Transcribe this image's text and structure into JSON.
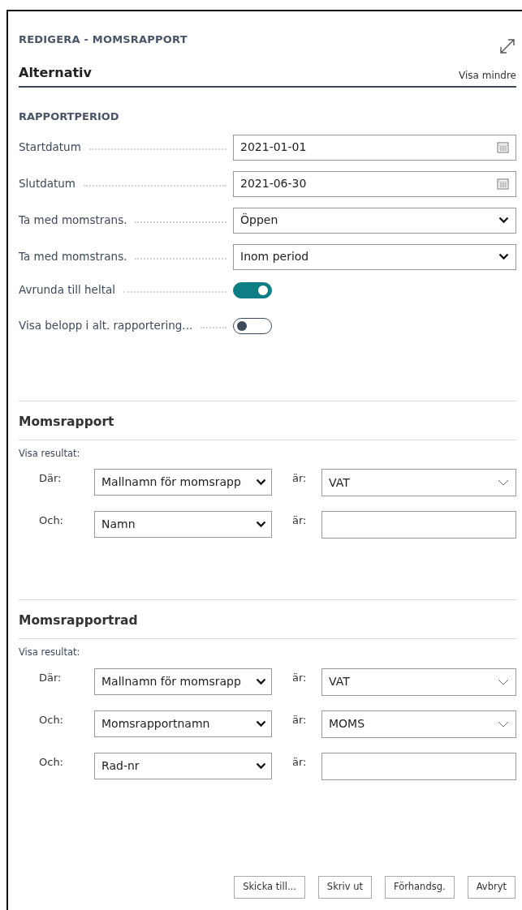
{
  "window": {
    "title": "REDIGERA - MOMSRAPPORT"
  },
  "options": {
    "title": "Alternativ",
    "toggle_link": "Visa mindre",
    "group": "RAPPORTPERIOD",
    "fields": [
      {
        "kind": "date",
        "label": "Startdatum",
        "value": "2021-01-01"
      },
      {
        "kind": "date",
        "label": "Slutdatum",
        "value": "2021-06-30"
      },
      {
        "kind": "select",
        "label": "Ta med momstrans.",
        "value": "Öppen"
      },
      {
        "kind": "select",
        "label": "Ta med momstrans.",
        "value": "Inom period"
      },
      {
        "kind": "toggle",
        "label": "Avrunda till heltal",
        "on": true
      },
      {
        "kind": "toggle",
        "label": "Visa belopp i alt. rapportering...",
        "on": false
      }
    ]
  },
  "filter_sections": [
    {
      "title": "Momsrapport",
      "caption": "Visa resultat:",
      "rows": [
        {
          "connector": "Där:",
          "field": "Mallnamn för momsrapp",
          "operator": "är:",
          "kind": "combo",
          "value": "VAT"
        },
        {
          "connector": "Och:",
          "field": "Namn",
          "operator": "är:",
          "kind": "text"
        }
      ]
    },
    {
      "title": "Momsrapportrad",
      "caption": "Visa resultat:",
      "rows": [
        {
          "connector": "Där:",
          "field": "Mallnamn för momsrapp",
          "operator": "är:",
          "kind": "combo",
          "value": "VAT"
        },
        {
          "connector": "Och:",
          "field": "Momsrapportnamn",
          "operator": "är:",
          "kind": "combo",
          "value": "MOMS"
        },
        {
          "connector": "Och:",
          "field": "Rad-nr",
          "operator": "är:",
          "kind": "text"
        }
      ]
    }
  ],
  "buttons": [
    "Skicka till...",
    "Skriv ut",
    "Förhandsg.",
    "Avbryt"
  ]
}
